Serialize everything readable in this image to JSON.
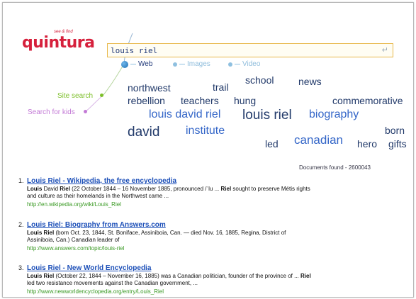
{
  "logo": {
    "text": "quintura",
    "tagline": "see & find"
  },
  "search": {
    "query": "louis riel",
    "enter_icon": "enter-icon"
  },
  "tabs": [
    {
      "label": "Web",
      "active": true
    },
    {
      "label": "Images",
      "active": false
    },
    {
      "label": "Video",
      "active": false
    }
  ],
  "side_links": {
    "site_search": "Site search",
    "kids_search": "Search for kids"
  },
  "cloud": {
    "northwest": "northwest",
    "trail": "trail",
    "school": "school",
    "news": "news",
    "rebellion": "rebellion",
    "teachers": "teachers",
    "hung": "hung",
    "commemorative": "commemorative",
    "louis_david_riel": "louis david riel",
    "louis_riel": "louis riel",
    "biography": "biography",
    "david": "david",
    "institute": "institute",
    "born": "born",
    "led": "led",
    "canadian": "canadian",
    "hero": "hero",
    "gifts": "gifts"
  },
  "documents_found": "Documents found - 2600043",
  "results": [
    {
      "number": "1.",
      "title": "Louis Riel - Wikipedia, the free encyclopedia",
      "snippet_line1_bold1": "Louis",
      "snippet_line1_text1": " David ",
      "snippet_line1_bold2": "Riel",
      "snippet_line1_text2": " (22 October 1844 – 16 November 1885, pronounced /ˈlu ... ",
      "snippet_line1_bold3": "Riel",
      "snippet_line1_text3": " sought to preserve Métis rights",
      "snippet_line2": "and culture as their homelands in the Northwest came ...",
      "url": "http://en.wikipedia.org/wiki/Louis_Riel"
    },
    {
      "number": "2.",
      "title": "Louis Riel: Biography from Answers.com",
      "snippet_line1_bold1": "Louis Riel",
      "snippet_line1_text1": " (born Oct. 23, 1844, St. Boniface, Assiniboia, Can. — died Nov. 16, 1885, Regina, District of",
      "snippet_line2": "Assiniboia, Can.) Canadian leader of",
      "url": "http://www.answers.com/topic/louis-riel"
    },
    {
      "number": "3.",
      "title": "Louis Riel - New World Encyclopedia",
      "snippet_line1_bold1": "Louis Riel",
      "snippet_line1_text1": " (October 22, 1844 – November 16, 1885) was a Canadian politician, founder of the province of ... ",
      "snippet_line1_bold2": "Riel",
      "snippet_line2": "led two resistance movements against the Canadian government, ...",
      "url": "http://www.newworldencyclopedia.org/entry/Louis_Riel"
    }
  ],
  "colors": {
    "logo": "#d6203c",
    "link": "#1c4fb8",
    "url": "#3a9a24",
    "cloud_dark": "#223a6a",
    "cloud_blue": "#3466c8",
    "search_border": "#e8b84a"
  }
}
